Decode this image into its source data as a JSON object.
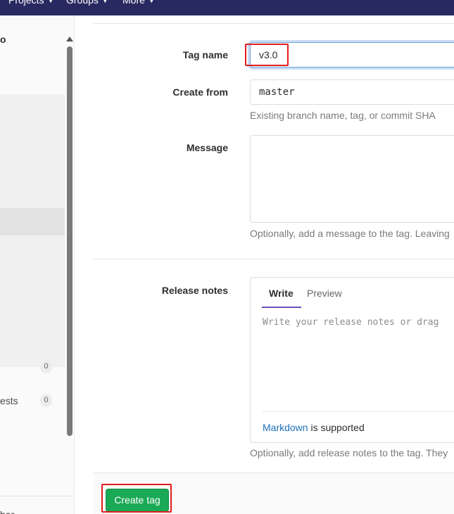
{
  "topnav": {
    "items": [
      {
        "label": "Projects"
      },
      {
        "label": "Groups"
      },
      {
        "label": "More"
      }
    ]
  },
  "sidebar": {
    "project_name_fragment": "o",
    "items": [
      {
        "label": "",
        "count": "0"
      },
      {
        "label": "ests",
        "count": "0"
      }
    ],
    "collapse_fragment": "bar"
  },
  "form": {
    "tag_name": {
      "label": "Tag name",
      "value": "v3.0"
    },
    "create_from": {
      "label": "Create from",
      "value": "master",
      "help": "Existing branch name, tag, or commit SHA"
    },
    "message": {
      "label": "Message",
      "value": "",
      "help": "Optionally, add a message to the tag. Leaving"
    },
    "release_notes": {
      "label": "Release notes",
      "tab_write": "Write",
      "tab_preview": "Preview",
      "placeholder": "Write your release notes or drag",
      "markdown_link": "Markdown",
      "markdown_suffix": " is supported",
      "help": "Optionally, add release notes to the tag. They"
    },
    "submit_label": "Create tag"
  },
  "colors": {
    "topnav_bg": "#292961",
    "primary_green": "#1aaa55",
    "highlight_red": "#e01d1d",
    "link_blue": "#1f6fb9",
    "tab_underline": "#6b4fbb"
  }
}
